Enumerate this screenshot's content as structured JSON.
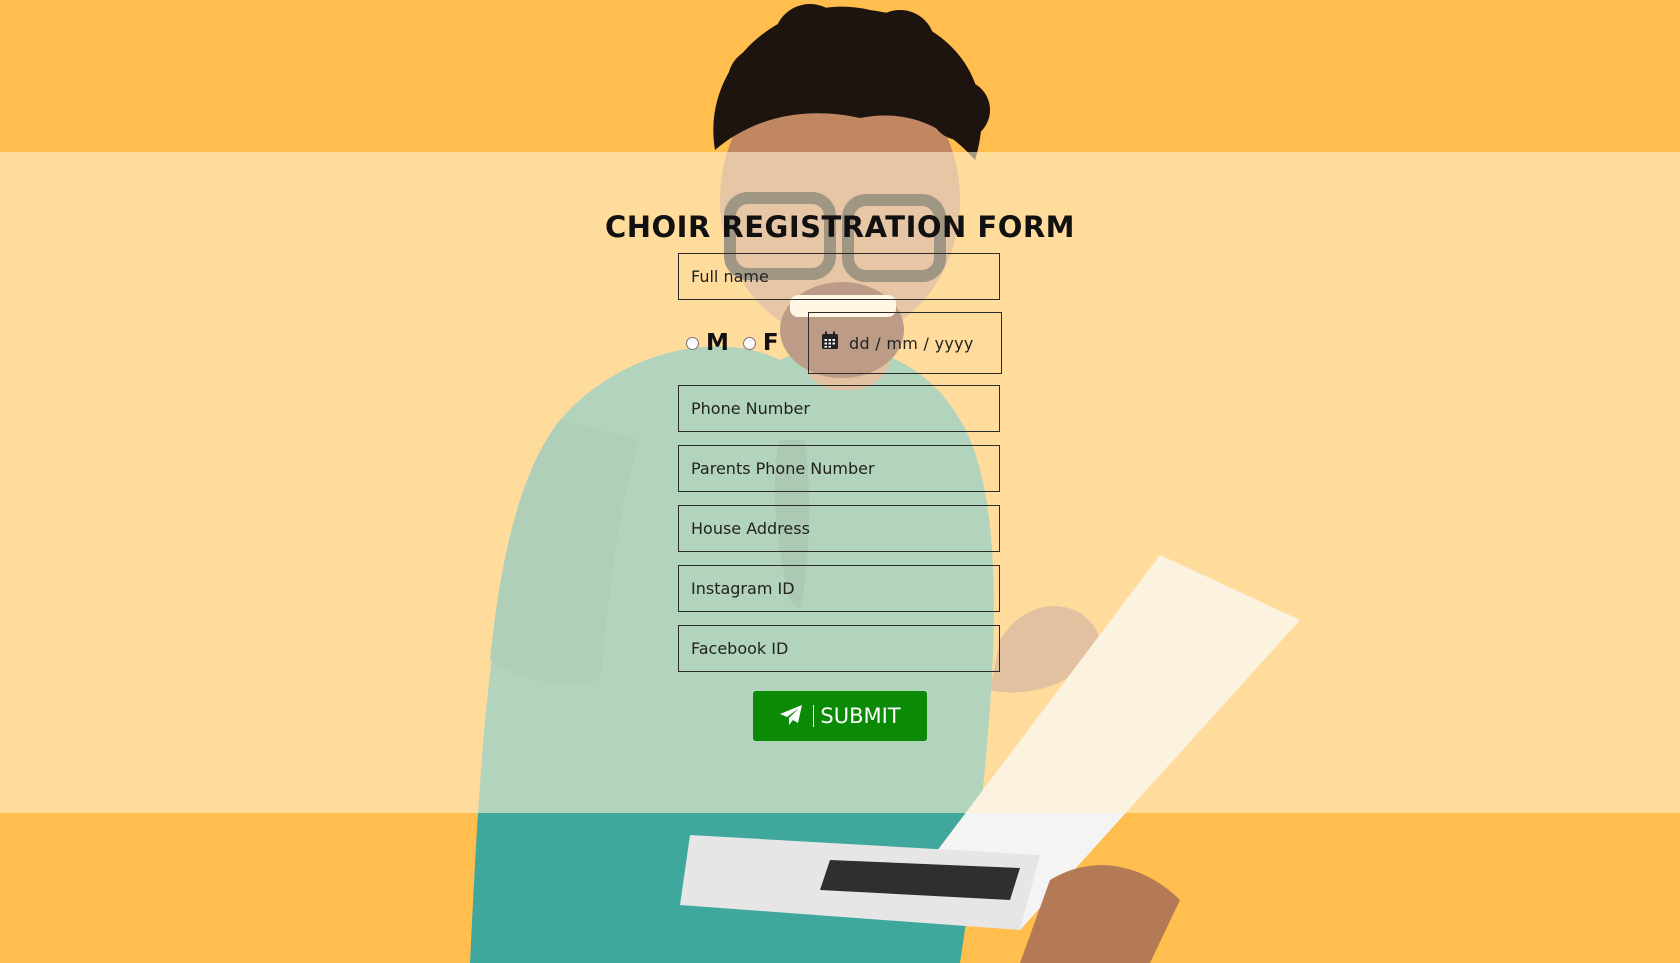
{
  "colors": {
    "background": "#ffbe4d",
    "overlay": "#fff0d2",
    "submit_bg": "#0a8a06",
    "text": "#111111"
  },
  "form": {
    "title": "CHOIR REGISTRATION FORM",
    "full_name_placeholder": "Full name",
    "gender": {
      "male_label": "M",
      "female_label": "F"
    },
    "dob_placeholder": "dd / mm / yyyy",
    "phone_placeholder": "Phone Number",
    "parents_phone_placeholder": "Parents Phone Number",
    "address_placeholder": "House Address",
    "instagram_placeholder": "Instagram ID",
    "facebook_placeholder": "Facebook ID",
    "submit_label": "SUBMIT",
    "submit_icon": "paper-plane-icon",
    "dob_icon": "calendar-icon"
  }
}
